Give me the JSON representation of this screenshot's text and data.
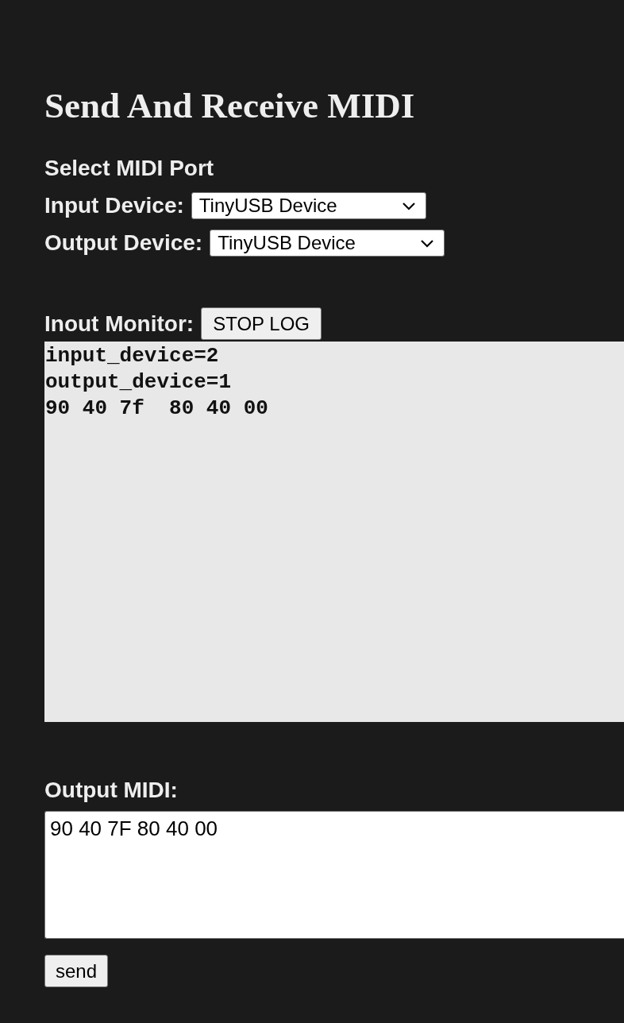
{
  "title": "Send And Receive MIDI",
  "port_section": {
    "heading": "Select MIDI Port",
    "devices": [
      {
        "label": "Input Device:",
        "value": "TinyUSB Device"
      },
      {
        "label": "Output Device:",
        "value": "TinyUSB Device"
      }
    ]
  },
  "monitor": {
    "label": "Inout Monitor:",
    "button": "STOP LOG",
    "lines": [
      "input_device=2",
      "output_device=1",
      "90 40 7f  80 40 00"
    ]
  },
  "output": {
    "label": "Output MIDI:",
    "value": "90 40 7F 80 40 00",
    "button": "send"
  }
}
